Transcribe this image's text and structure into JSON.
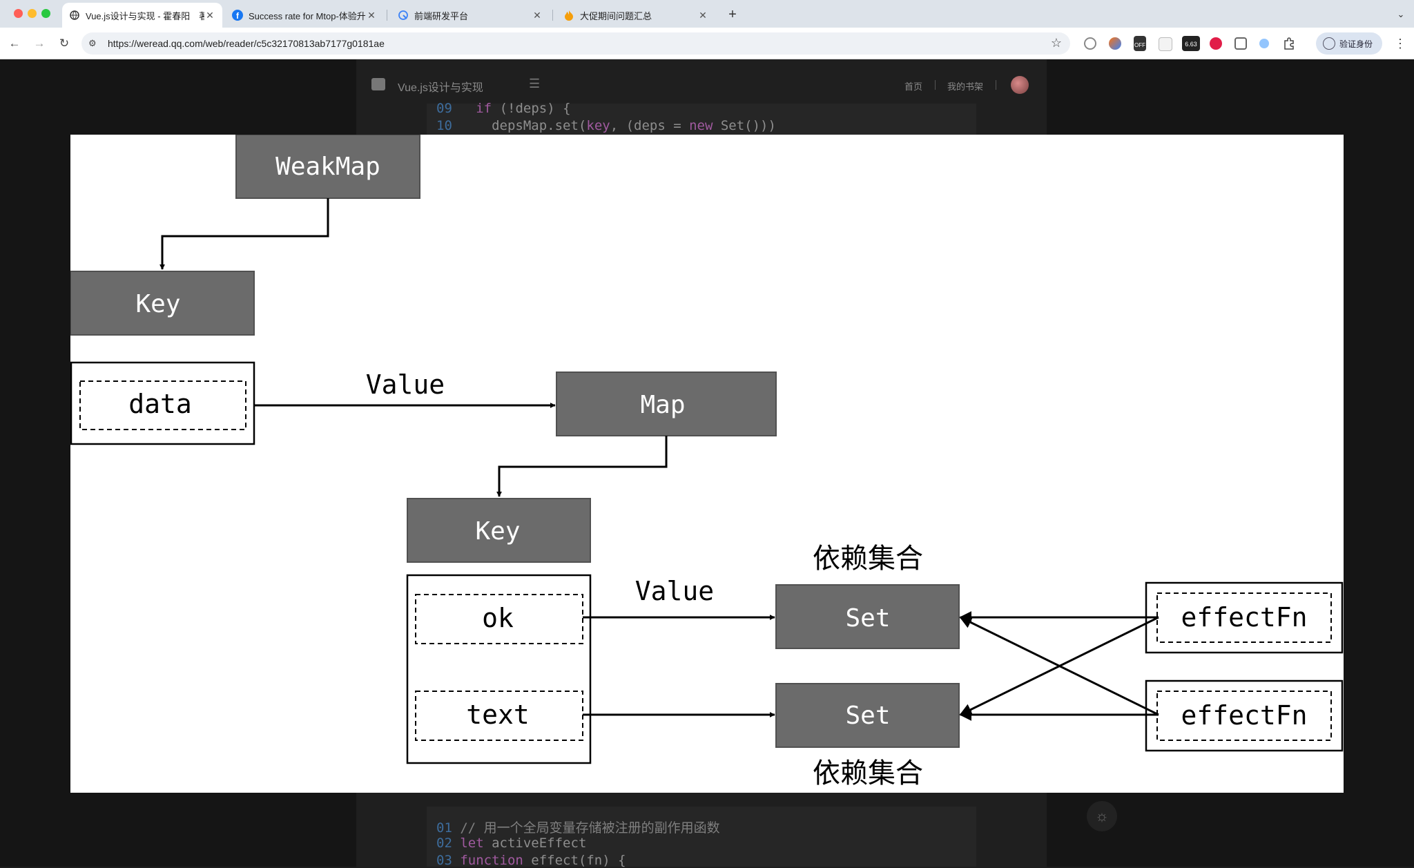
{
  "browser": {
    "tabs": [
      {
        "title": "Vue.js设计与实现 - 霍春阳　著",
        "active": true
      },
      {
        "title": "Success rate for Mtop-体验升级",
        "active": false
      },
      {
        "title": "前端研发平台",
        "active": false
      },
      {
        "title": "大促期间问题汇总",
        "active": false
      }
    ],
    "url": "https://weread.qq.com/web/reader/c5c32170813ab7177g0181ae",
    "profile_label": "验证身份",
    "extension_badges": {
      "off": "OFF",
      "number": "6.63"
    }
  },
  "reader": {
    "book_title": "Vue.js设计与实现",
    "nav_home": "首页",
    "nav_shelf": "我的书架",
    "code_top": [
      {
        "n": "09",
        "pre": "  ",
        "kw": "if",
        "rest": " (!deps) {"
      },
      {
        "n": "10",
        "pre": "    depsMap.set(",
        "kw": "key",
        "rest": ", (deps = ",
        "kw2": "new",
        "rest2": " Set()))"
      }
    ],
    "code_bottom": [
      {
        "n": "01",
        "text": "// 用一个全局变量存储被注册的副作用函数"
      },
      {
        "n": "02",
        "kw": "let",
        "rest": " activeEffect"
      },
      {
        "n": "03",
        "kw": "function",
        "rest": " effect(fn) {"
      }
    ]
  },
  "diagram": {
    "weakmap": "WeakMap",
    "key1": "Key",
    "data": "data",
    "value1": "Value",
    "map": "Map",
    "key2": "Key",
    "ok": "ok",
    "text": "text",
    "value2": "Value",
    "set1": "Set",
    "set2": "Set",
    "dep_label_top": "依赖集合",
    "dep_label_bottom": "依赖集合",
    "effect1": "effectFn",
    "effect2": "effectFn",
    "colors": {
      "box": "#6b6b6b",
      "box_border": "#505050",
      "box_text": "#ffffff",
      "line": "#000000"
    }
  }
}
